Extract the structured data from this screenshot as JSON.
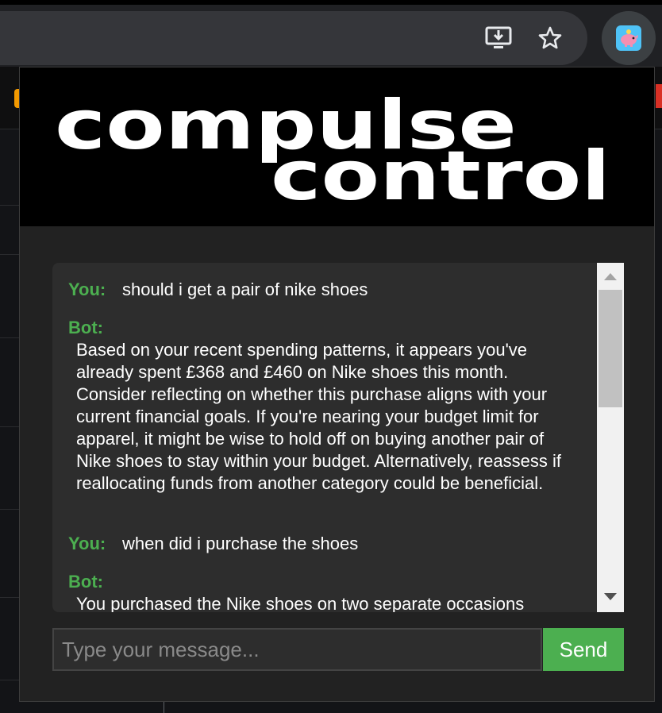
{
  "browser": {
    "toolbar_icons": [
      "install-app-icon",
      "bookmark-star-icon"
    ],
    "extension_icon": "piggy-bank-icon"
  },
  "popup": {
    "logo_line1": "compulse",
    "logo_line2": "control",
    "messages": [
      {
        "role": "You:",
        "text": "should i get a pair of nike shoes"
      },
      {
        "role": "Bot:",
        "text": "Based on your recent spending patterns, it appears you've already spent £368 and £460 on Nike shoes this month. Consider reflecting on whether this purchase aligns with your current financial goals. If you're nearing your budget limit for apparel, it might be wise to hold off on buying another pair of Nike shoes to stay within your budget. Alternatively, reassess if reallocating funds from another category could be beneficial."
      },
      {
        "role": "You:",
        "text": "when did i purchase the shoes"
      },
      {
        "role": "Bot:",
        "text": "You purchased the Nike shoes on two separate occasions"
      }
    ],
    "input": {
      "value": "",
      "placeholder": "Type your message..."
    },
    "send_label": "Send",
    "colors": {
      "accent": "#4caf50",
      "header_bg": "#000000",
      "chat_bg": "#2d2d2d"
    }
  }
}
